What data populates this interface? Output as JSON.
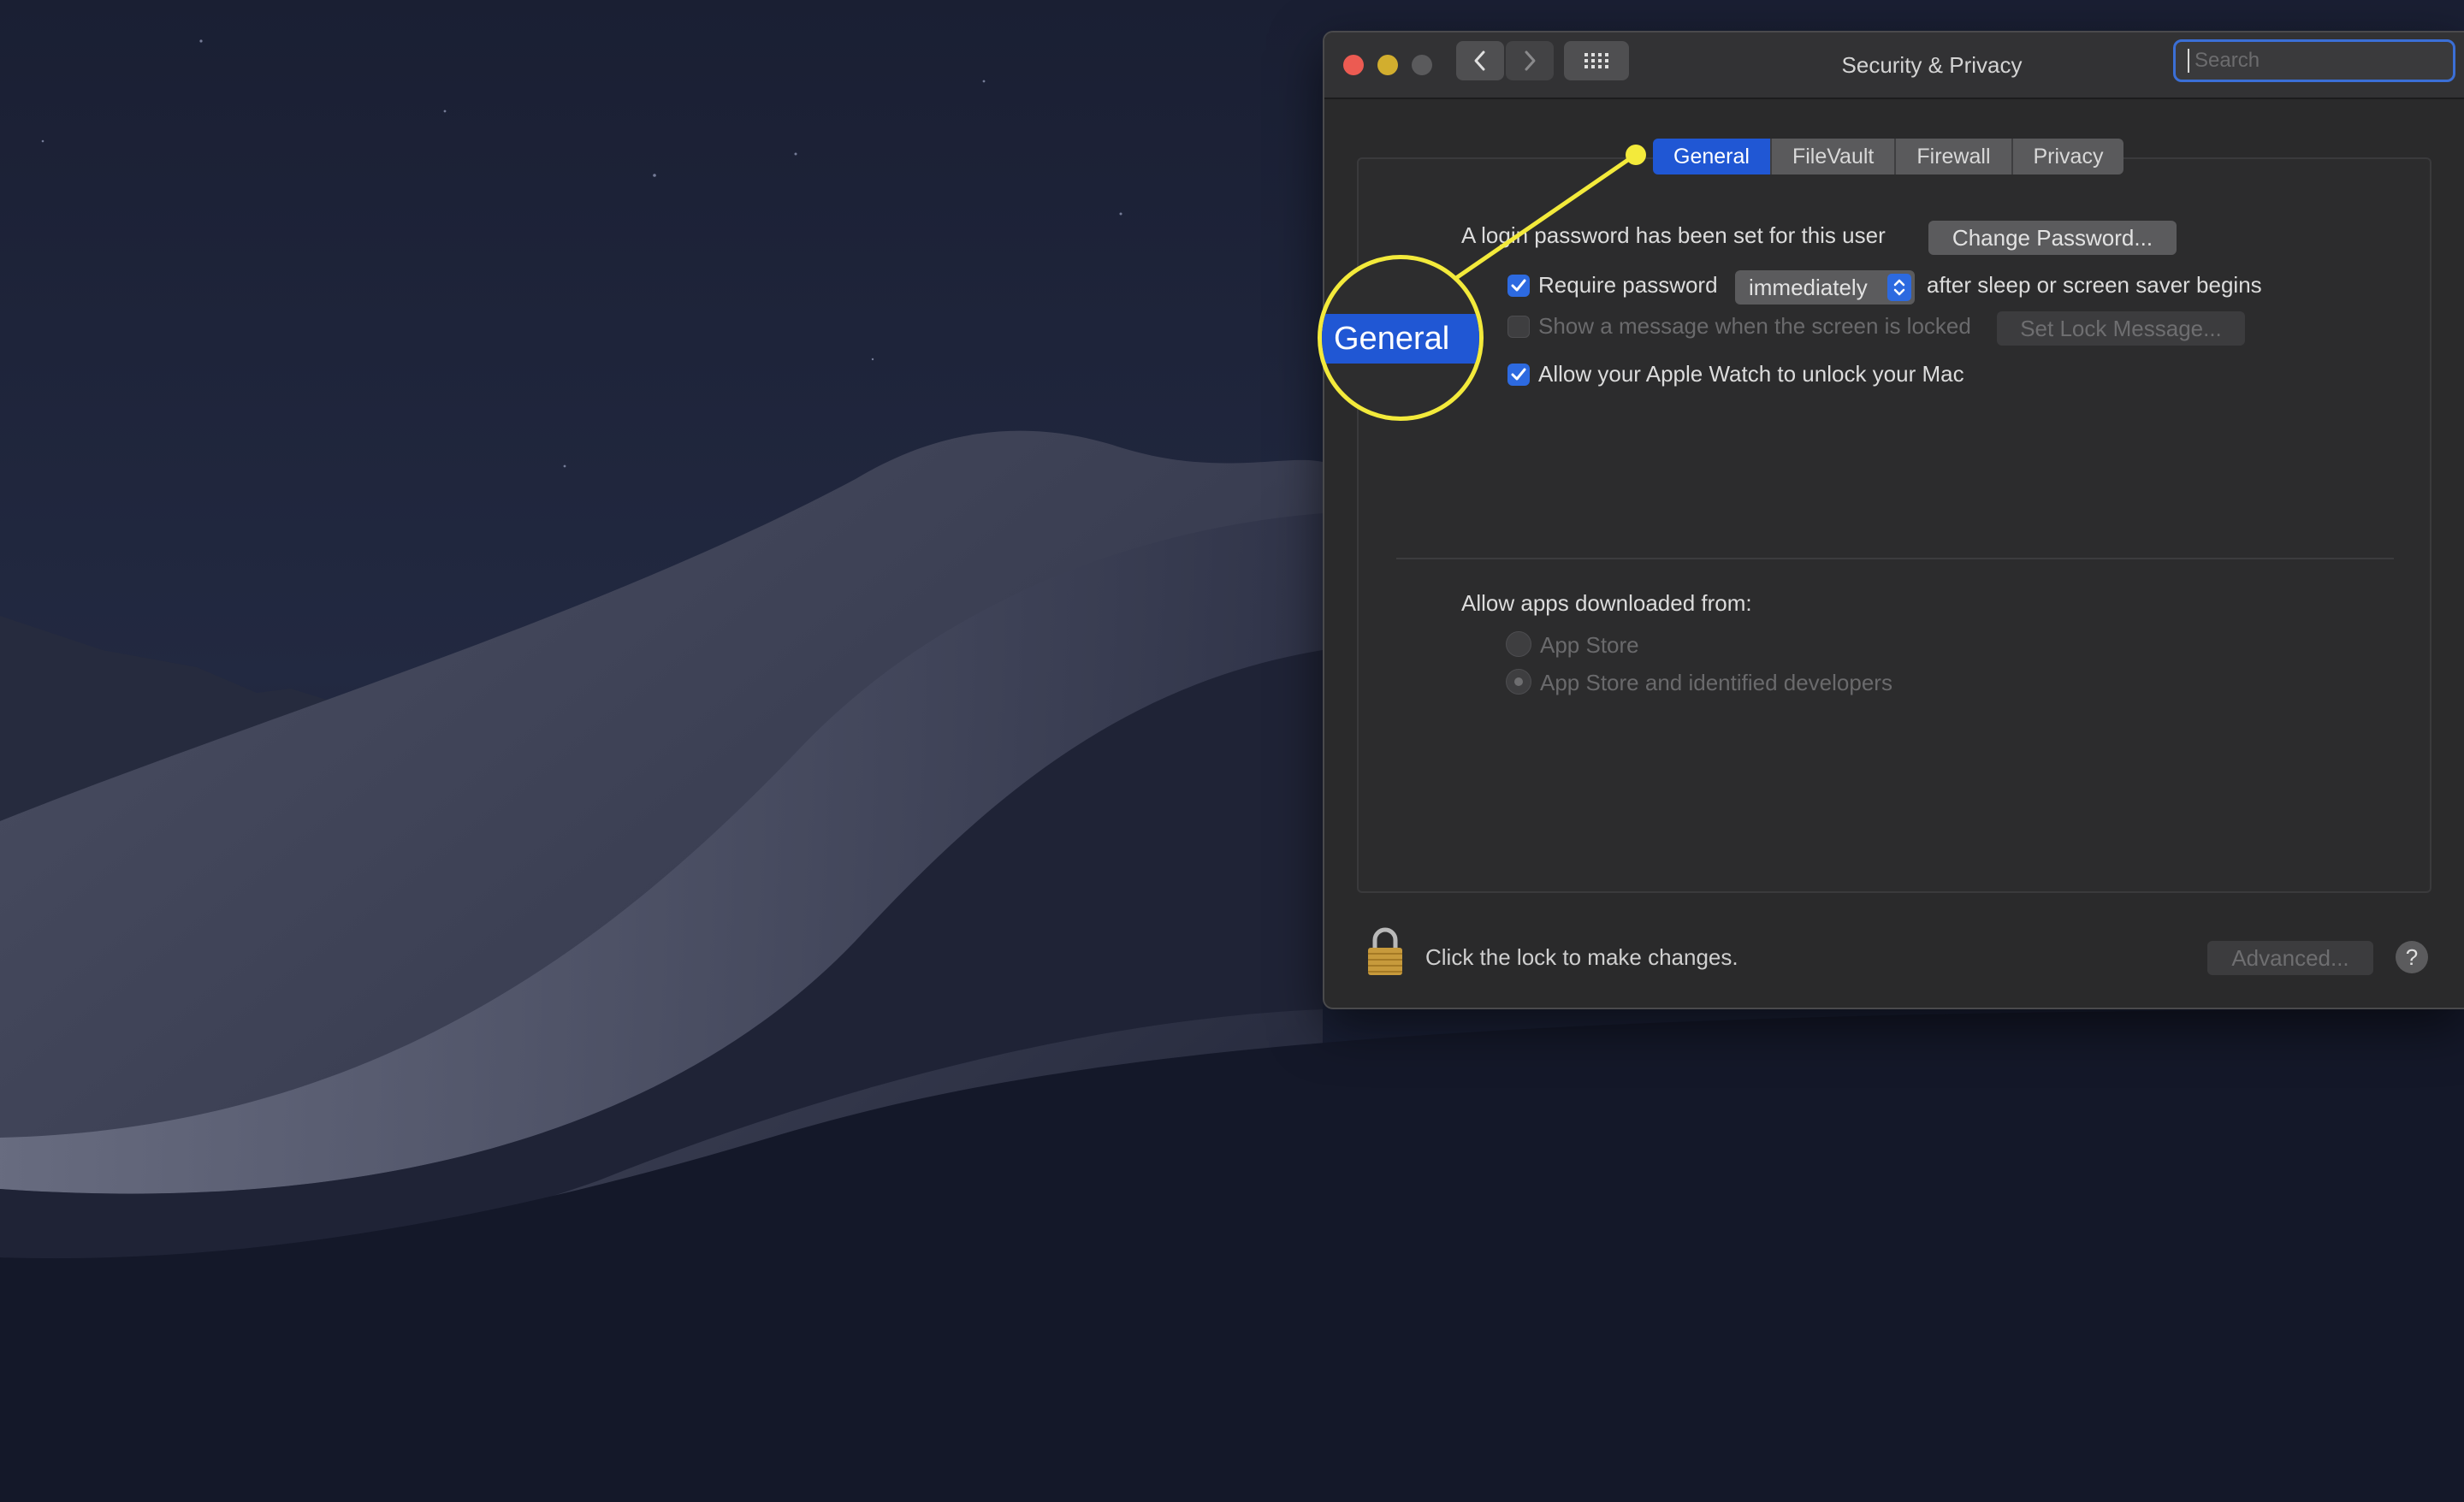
{
  "window": {
    "title": "Security & Privacy",
    "search_placeholder": "Search"
  },
  "tabs": [
    {
      "label": "General",
      "active": true
    },
    {
      "label": "FileVault",
      "active": false
    },
    {
      "label": "Firewall",
      "active": false
    },
    {
      "label": "Privacy",
      "active": false
    }
  ],
  "general": {
    "login_text": "A login password has been set for this user",
    "change_password_button": "Change Password...",
    "require_password": {
      "label": "Require password",
      "checked": true
    },
    "require_password_delay": "immediately",
    "require_password_suffix": "after sleep or screen saver begins",
    "show_message": {
      "label": "Show a message when the screen is locked",
      "checked": false,
      "enabled": false
    },
    "set_lock_message_button": "Set Lock Message...",
    "apple_watch": {
      "label": "Allow your Apple Watch to unlock your Mac",
      "checked": true
    },
    "allow_apps_heading": "Allow apps downloaded from:",
    "allow_apps_options": [
      {
        "label": "App Store",
        "selected": false,
        "enabled": false
      },
      {
        "label": "App Store and identified developers",
        "selected": true,
        "enabled": false
      }
    ]
  },
  "footer": {
    "lock_text": "Click the lock to make changes.",
    "advanced_button": "Advanced...",
    "help_button": "?"
  },
  "callout": {
    "label": "General",
    "color": "#f3ea3b"
  },
  "colors": {
    "accent": "#2057d4",
    "close": "#ec5b52",
    "minimize": "#d2ae2e",
    "zoom_disabled": "#5a5a5c"
  }
}
